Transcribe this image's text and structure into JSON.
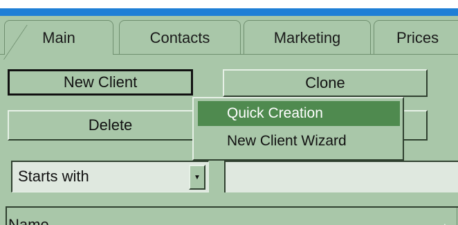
{
  "tabs": [
    {
      "label": "Main",
      "active": true
    },
    {
      "label": "Contacts",
      "active": false
    },
    {
      "label": "Marketing",
      "active": false
    },
    {
      "label": "Prices",
      "active": false
    }
  ],
  "buttons": {
    "new_client": "New Client",
    "clone": "Clone",
    "delete": "Delete"
  },
  "search": {
    "mode_selected": "Starts with",
    "text_value": ""
  },
  "list": {
    "column_header": "Name",
    "sort_icon": "triangle-up-icon"
  },
  "menu": {
    "items": [
      "Quick Creation",
      "New Client Wizard"
    ],
    "highlighted_index": 0
  },
  "colors": {
    "panel": "#a9c7a9",
    "title_bar": "#1f7fd6",
    "highlight": "#4f8a4f"
  }
}
